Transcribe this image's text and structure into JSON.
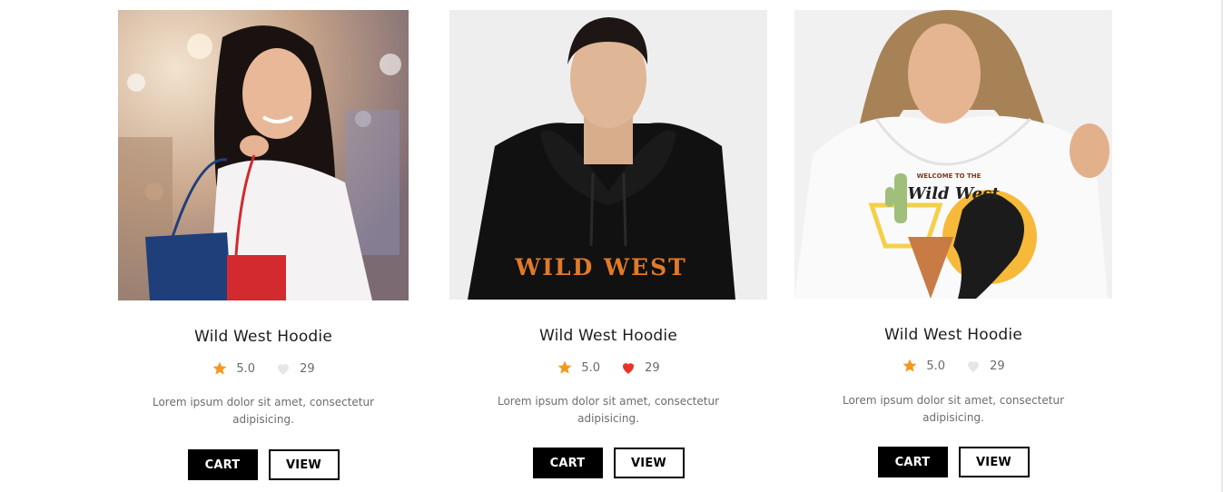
{
  "products": [
    {
      "title": "Wild West Hoodie",
      "rating": "5.0",
      "likes": "29",
      "liked": false,
      "description_line1": "Lorem ipsum dolor sit amet, consectetur",
      "description_line2": "adipisicing.",
      "cart_label": "CART",
      "view_label": "VIEW",
      "image_desc": "woman-with-shopping-bags"
    },
    {
      "title": "Wild West Hoodie",
      "rating": "5.0",
      "likes": "29",
      "liked": true,
      "description_line1": "Lorem ipsum dolor sit amet, consectetur",
      "description_line2": "adipisicing.",
      "cart_label": "CART",
      "view_label": "VIEW",
      "print_text": "WILD WEST",
      "image_desc": "man-in-black-hoodie"
    },
    {
      "title": "Wild West Hoodie",
      "rating": "5.0",
      "likes": "29",
      "liked": false,
      "description_line1": "Lorem ipsum dolor sit amet, consectetur",
      "description_line2": "adipisicing.",
      "cart_label": "CART",
      "view_label": "VIEW",
      "print_text_top": "WELCOME TO THE",
      "print_text_main": "Wild West",
      "image_desc": "woman-in-white-hoodie"
    }
  ],
  "colors": {
    "star": "#f29a1f",
    "heart_liked": "#e8332a",
    "heart_unliked": "#e4e6e8",
    "button_dark": "#000000"
  }
}
